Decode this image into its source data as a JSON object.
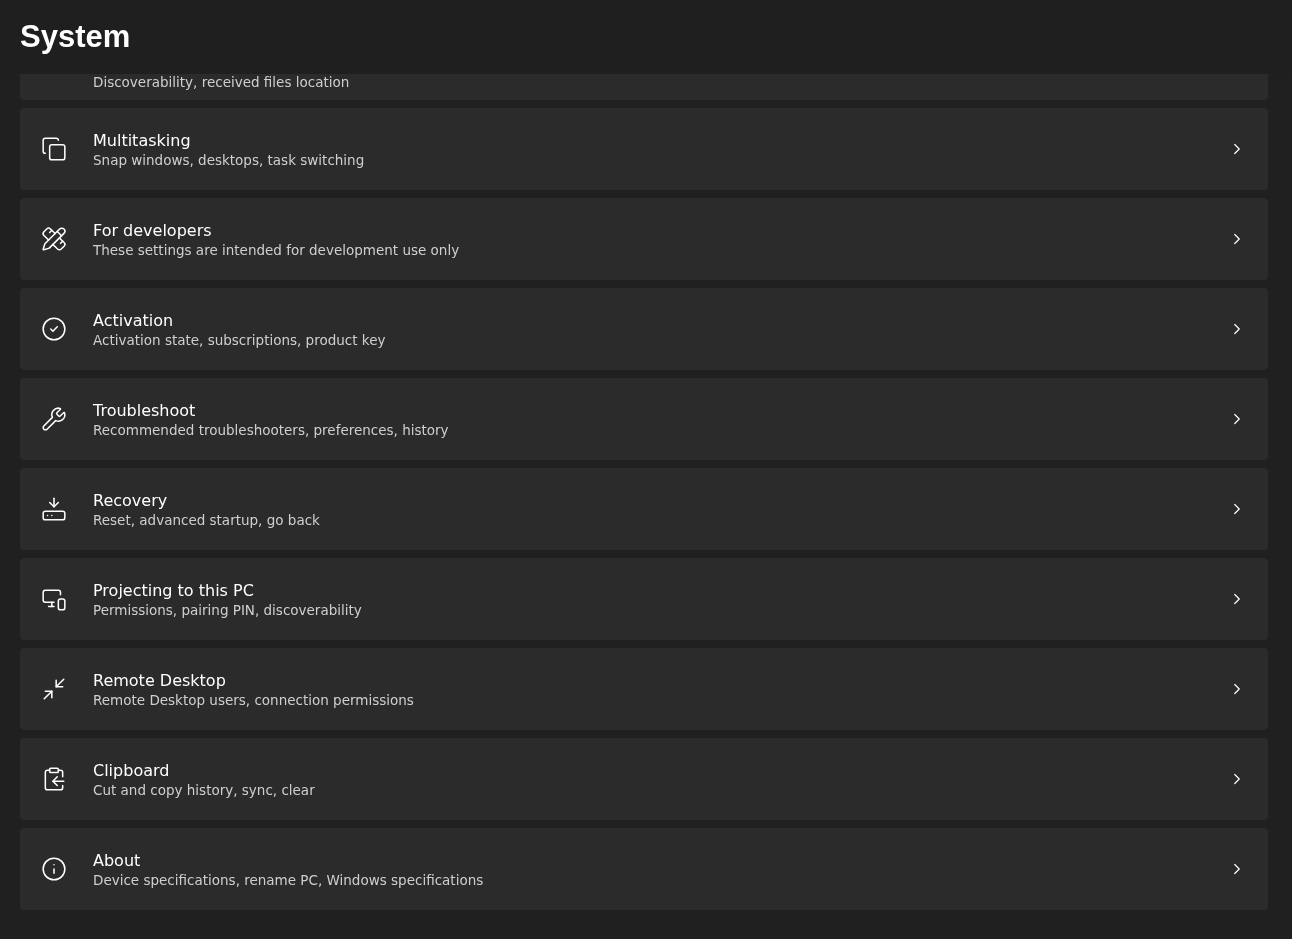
{
  "window": {
    "title": "System"
  },
  "partial_item": {
    "subtitle": "Discoverability, received files location"
  },
  "items": [
    {
      "title": "Multitasking",
      "subtitle": "Snap windows, desktops, task switching"
    },
    {
      "title": "For developers",
      "subtitle": "These settings are intended for development use only"
    },
    {
      "title": "Activation",
      "subtitle": "Activation state, subscriptions, product key"
    },
    {
      "title": "Troubleshoot",
      "subtitle": "Recommended troubleshooters, preferences, history"
    },
    {
      "title": "Recovery",
      "subtitle": "Reset, advanced startup, go back"
    },
    {
      "title": "Projecting to this PC",
      "subtitle": "Permissions, pairing PIN, discoverability"
    },
    {
      "title": "Remote Desktop",
      "subtitle": "Remote Desktop users, connection permissions"
    },
    {
      "title": "Clipboard",
      "subtitle": "Cut and copy history, sync, clear"
    },
    {
      "title": "About",
      "subtitle": "Device specifications, rename PC, Windows specifications"
    }
  ]
}
